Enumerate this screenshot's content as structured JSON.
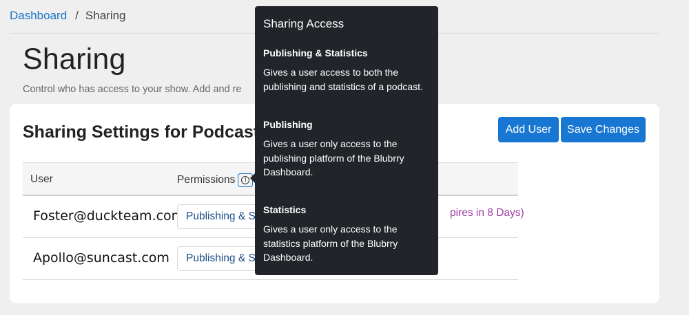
{
  "breadcrumb": {
    "home": "Dashboard",
    "separator": "/",
    "current": "Sharing"
  },
  "page": {
    "title": "Sharing",
    "subtitle": "Control who has access to your show. Add and re"
  },
  "card": {
    "title": "Sharing Settings for Podcast I",
    "add_user_label": "Add User",
    "save_label": "Save Changes"
  },
  "table": {
    "headers": {
      "user": "User",
      "permissions": "Permissions"
    },
    "info_icon_glyph": "i",
    "rows": [
      {
        "user": "Foster@duckteam.com",
        "permission": "Publishing & Statistics",
        "status": "(Expires in 8 Days)",
        "status_visible": "pires in 8 Days)"
      },
      {
        "user": "Apollo@suncast.com",
        "permission": "Publishing & Statistics",
        "status": ""
      }
    ]
  },
  "tooltip": {
    "title": "Sharing Access",
    "sections": [
      {
        "heading": "Publishing & Statistics",
        "text": "Gives a user access to both the publishing and statistics of a podcast."
      },
      {
        "heading": "Publishing",
        "text": "Gives a user only access to the publishing platform of the Blubrry Dashboard."
      },
      {
        "heading": "Statistics",
        "text": "Gives a user only access to the statistics platform of the Blubrry Dashboard."
      }
    ]
  },
  "colors": {
    "accent": "#1877d2",
    "link": "#1a73c7",
    "status_expiring": "#a23aa8",
    "tooltip_bg": "#212529"
  }
}
